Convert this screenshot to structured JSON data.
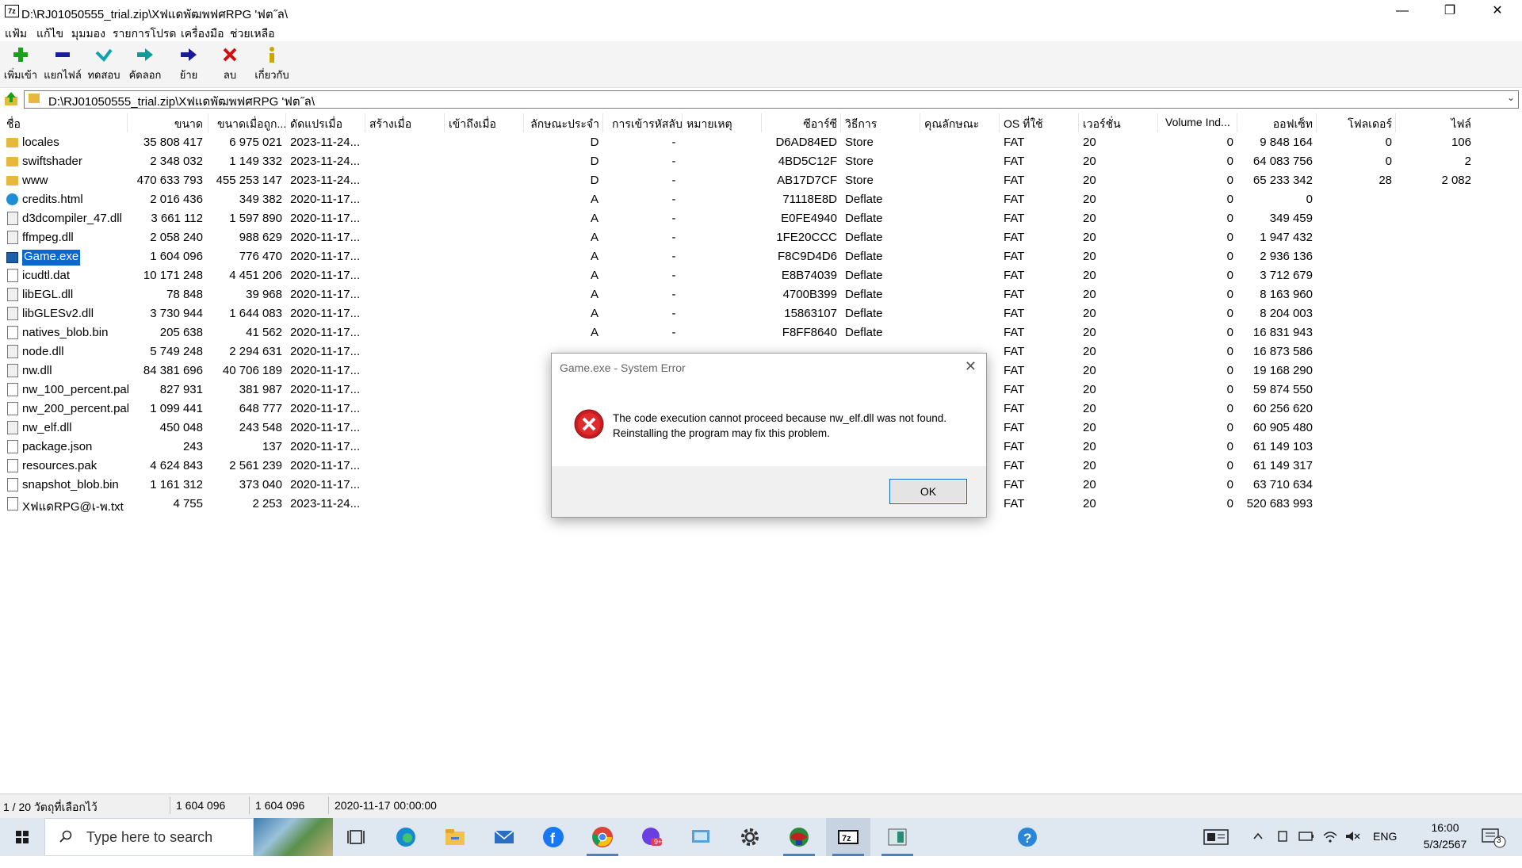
{
  "window": {
    "icon_label": "7z",
    "title": "D:\\RJ01050555_trial.zip\\Xฟแดพัฒพฟศ‎RPG 'ฟต˝ล\\",
    "minimize": "—",
    "maximize": "❐",
    "close": "✕"
  },
  "menu": [
    "แฟ้ม",
    "แก้ไข",
    "มุมมอง",
    "รายการโปรด",
    "เครื่องมือ",
    "ช่วยเหลือ"
  ],
  "toolbar": [
    {
      "label": "เพิ่มเข้า",
      "icon": "add-icon",
      "color": "#1aa01a"
    },
    {
      "label": "แยกไฟล์",
      "icon": "extract-icon",
      "color": "#1a1aa0"
    },
    {
      "label": "ทดสอบ",
      "icon": "test-icon",
      "color": "#10a0b0"
    },
    {
      "label": "คัดลอก",
      "icon": "copy-icon",
      "color": "#10a0a0"
    },
    {
      "label": "ย้าย",
      "icon": "move-icon",
      "color": "#1a1a9a"
    },
    {
      "label": "ลบ",
      "icon": "delete-icon",
      "color": "#d01010"
    },
    {
      "label": "เกี่ยวกับ",
      "icon": "info-icon",
      "color": "#c8a800"
    }
  ],
  "address": "D:\\RJ01050555_trial.zip\\Xฟแดพัฒพฟศ‎RPG 'ฟต˝ล\\",
  "columns": [
    "ชื่อ",
    "ขนาด",
    "ขนาดเมื่อถูก...",
    "ดัดแปรเมื่อ",
    "สร้างเมื่อ",
    "เข้าถึงเมื่อ",
    "ลักษณะประจำ",
    "การเข้ารหัสลับ",
    "หมายเหตุ",
    "ซีอาร์ซี",
    "วิธีการ",
    "คุณลักษณะ",
    "OS ที่ใช้",
    "เวอร์ชั่น",
    "Volume Ind...",
    "ออฟเซ็ท",
    "โฟลเดอร์",
    "ไฟล์"
  ],
  "rows": [
    {
      "name": "locales",
      "type": "folder",
      "size": "35 808 417",
      "packed": "6 975 021",
      "modified": "2023-11-24...",
      "attr": "D",
      "enc": "-",
      "crc": "D6AD84ED",
      "method": "Store",
      "os": "FAT",
      "ver": "20",
      "vol": "0",
      "offset": "9 848 164",
      "folders": "0",
      "files": "106"
    },
    {
      "name": "swiftshader",
      "type": "folder",
      "size": "2 348 032",
      "packed": "1 149 332",
      "modified": "2023-11-24...",
      "attr": "D",
      "enc": "-",
      "crc": "4BD5C12F",
      "method": "Store",
      "os": "FAT",
      "ver": "20",
      "vol": "0",
      "offset": "64 083 756",
      "folders": "0",
      "files": "2"
    },
    {
      "name": "www",
      "type": "folder",
      "size": "470 633 793",
      "packed": "455 253 147",
      "modified": "2023-11-24...",
      "attr": "D",
      "enc": "-",
      "crc": "AB17D7CF",
      "method": "Store",
      "os": "FAT",
      "ver": "20",
      "vol": "0",
      "offset": "65 233 342",
      "folders": "28",
      "files": "2 082"
    },
    {
      "name": "credits.html",
      "type": "html",
      "size": "2 016 436",
      "packed": "349 382",
      "modified": "2020-11-17...",
      "attr": "A",
      "enc": "-",
      "crc": "71118E8D",
      "method": "Deflate",
      "os": "FAT",
      "ver": "20",
      "vol": "0",
      "offset": "0",
      "folders": "",
      "files": ""
    },
    {
      "name": "d3dcompiler_47.dll",
      "type": "dll",
      "size": "3 661 112",
      "packed": "1 597 890",
      "modified": "2020-11-17...",
      "attr": "A",
      "enc": "-",
      "crc": "E0FE4940",
      "method": "Deflate",
      "os": "FAT",
      "ver": "20",
      "vol": "0",
      "offset": "349 459",
      "folders": "",
      "files": ""
    },
    {
      "name": "ffmpeg.dll",
      "type": "dll",
      "size": "2 058 240",
      "packed": "988 629",
      "modified": "2020-11-17...",
      "attr": "A",
      "enc": "-",
      "crc": "1FE20CCC",
      "method": "Deflate",
      "os": "FAT",
      "ver": "20",
      "vol": "0",
      "offset": "1 947 432",
      "folders": "",
      "files": ""
    },
    {
      "name": "Game.exe",
      "type": "exe",
      "selected": true,
      "size": "1 604 096",
      "packed": "776 470",
      "modified": "2020-11-17...",
      "attr": "A",
      "enc": "-",
      "crc": "F8C9D4D6",
      "method": "Deflate",
      "os": "FAT",
      "ver": "20",
      "vol": "0",
      "offset": "2 936 136",
      "folders": "",
      "files": ""
    },
    {
      "name": "icudtl.dat",
      "type": "file",
      "size": "10 171 248",
      "packed": "4 451 206",
      "modified": "2020-11-17...",
      "attr": "A",
      "enc": "-",
      "crc": "E8B74039",
      "method": "Deflate",
      "os": "FAT",
      "ver": "20",
      "vol": "0",
      "offset": "3 712 679",
      "folders": "",
      "files": ""
    },
    {
      "name": "libEGL.dll",
      "type": "dll",
      "size": "78 848",
      "packed": "39 968",
      "modified": "2020-11-17...",
      "attr": "A",
      "enc": "-",
      "crc": "4700B399",
      "method": "Deflate",
      "os": "FAT",
      "ver": "20",
      "vol": "0",
      "offset": "8 163 960",
      "folders": "",
      "files": ""
    },
    {
      "name": "libGLESv2.dll",
      "type": "dll",
      "size": "3 730 944",
      "packed": "1 644 083",
      "modified": "2020-11-17...",
      "attr": "A",
      "enc": "-",
      "crc": "15863107",
      "method": "Deflate",
      "os": "FAT",
      "ver": "20",
      "vol": "0",
      "offset": "8 204 003",
      "folders": "",
      "files": ""
    },
    {
      "name": "natives_blob.bin",
      "type": "file",
      "size": "205 638",
      "packed": "41 562",
      "modified": "2020-11-17...",
      "attr": "A",
      "enc": "-",
      "crc": "F8FF8640",
      "method": "Deflate",
      "os": "FAT",
      "ver": "20",
      "vol": "0",
      "offset": "16 831 943",
      "folders": "",
      "files": ""
    },
    {
      "name": "node.dll",
      "type": "dll",
      "size": "5 749 248",
      "packed": "2 294 631",
      "modified": "2020-11-17...",
      "attr": "",
      "enc": "",
      "crc": "",
      "method": "",
      "os": "FAT",
      "ver": "20",
      "vol": "0",
      "offset": "16 873 586",
      "folders": "",
      "files": ""
    },
    {
      "name": "nw.dll",
      "type": "dll",
      "size": "84 381 696",
      "packed": "40 706 189",
      "modified": "2020-11-17...",
      "attr": "",
      "enc": "",
      "crc": "",
      "method": "",
      "os": "FAT",
      "ver": "20",
      "vol": "0",
      "offset": "19 168 290",
      "folders": "",
      "files": ""
    },
    {
      "name": "nw_100_percent.pak",
      "type": "file",
      "size": "827 931",
      "packed": "381 987",
      "modified": "2020-11-17...",
      "attr": "",
      "enc": "",
      "crc": "",
      "method": "",
      "os": "FAT",
      "ver": "20",
      "vol": "0",
      "offset": "59 874 550",
      "folders": "",
      "files": ""
    },
    {
      "name": "nw_200_percent.pak",
      "type": "file",
      "size": "1 099 441",
      "packed": "648 777",
      "modified": "2020-11-17...",
      "attr": "",
      "enc": "",
      "crc": "",
      "method": "",
      "os": "FAT",
      "ver": "20",
      "vol": "0",
      "offset": "60 256 620",
      "folders": "",
      "files": ""
    },
    {
      "name": "nw_elf.dll",
      "type": "dll",
      "size": "450 048",
      "packed": "243 548",
      "modified": "2020-11-17...",
      "attr": "",
      "enc": "",
      "crc": "",
      "method": "",
      "os": "FAT",
      "ver": "20",
      "vol": "0",
      "offset": "60 905 480",
      "folders": "",
      "files": ""
    },
    {
      "name": "package.json",
      "type": "file",
      "size": "243",
      "packed": "137",
      "modified": "2020-11-17...",
      "attr": "",
      "enc": "",
      "crc": "",
      "method": "",
      "os": "FAT",
      "ver": "20",
      "vol": "0",
      "offset": "61 149 103",
      "folders": "",
      "files": ""
    },
    {
      "name": "resources.pak",
      "type": "file",
      "size": "4 624 843",
      "packed": "2 561 239",
      "modified": "2020-11-17...",
      "attr": "",
      "enc": "",
      "crc": "",
      "method": "",
      "os": "FAT",
      "ver": "20",
      "vol": "0",
      "offset": "61 149 317",
      "folders": "",
      "files": ""
    },
    {
      "name": "snapshot_blob.bin",
      "type": "file",
      "size": "1 161 312",
      "packed": "373 040",
      "modified": "2020-11-17...",
      "attr": "",
      "enc": "",
      "crc": "",
      "method": "",
      "os": "FAT",
      "ver": "20",
      "vol": "0",
      "offset": "63 710 634",
      "folders": "",
      "files": ""
    },
    {
      "name": "XฟแดRPG@เ-พ.txt",
      "type": "file",
      "size": "4 755",
      "packed": "2 253",
      "modified": "2023-11-24...",
      "attr": "",
      "enc": "",
      "crc": "",
      "method": "",
      "os": "FAT",
      "ver": "20",
      "vol": "0",
      "offset": "520 683 993",
      "folders": "",
      "files": ""
    }
  ],
  "status": {
    "selection": "1 / 20 วัตถุที่เลือกไว้",
    "size": "1 604 096",
    "packed": "1 604 096",
    "date": "2020-11-17 00:00:00"
  },
  "dialog": {
    "title": "Game.exe - System Error",
    "close": "✕",
    "line1": "The code execution cannot proceed because nw_elf.dll was not found.",
    "line2": "Reinstalling the program may fix this problem.",
    "ok": "OK"
  },
  "taskbar": {
    "search_placeholder": "Type here to search",
    "lang": "ENG",
    "time": "16:00",
    "date": "5/3/2567",
    "notif_count": "3",
    "badge": "9+"
  }
}
